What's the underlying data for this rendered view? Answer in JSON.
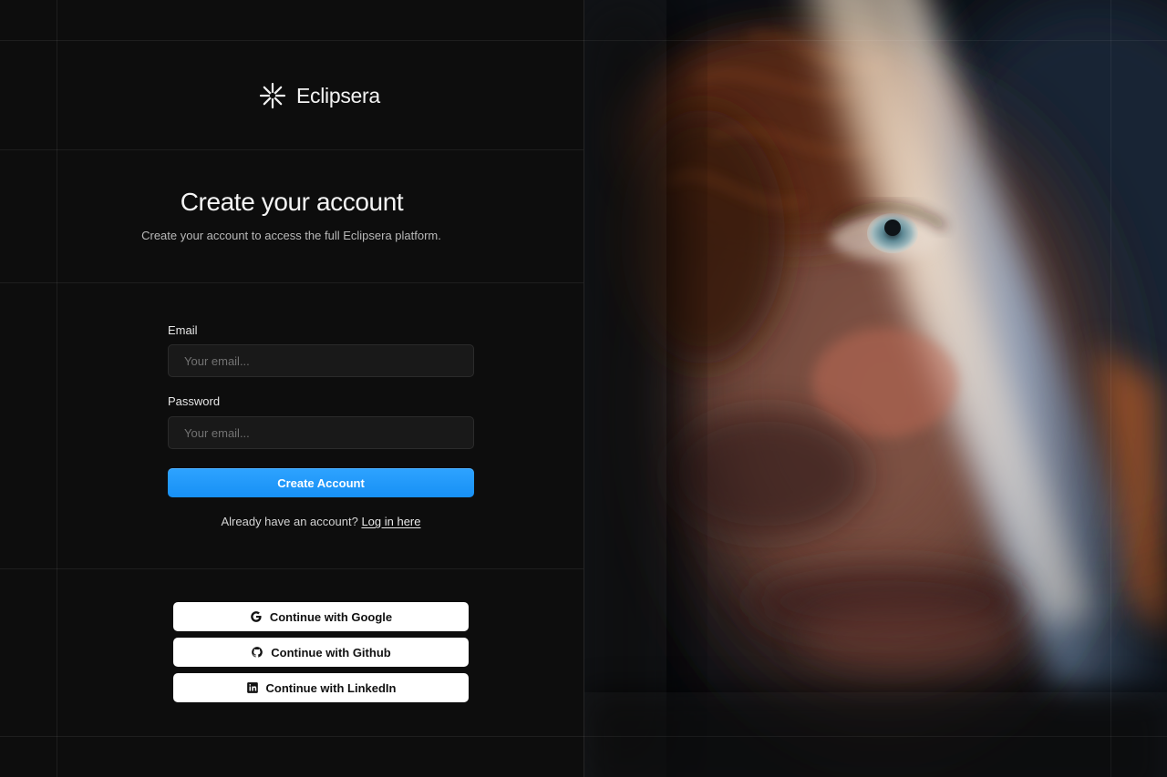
{
  "brand": {
    "name": "Eclipsera",
    "logo_icon": "sparkle-burst-icon"
  },
  "heading": {
    "title": "Create your account",
    "subtitle": "Create your account to access the full Eclipsera platform."
  },
  "form": {
    "email": {
      "label": "Email",
      "placeholder": "Your email...",
      "value": ""
    },
    "password": {
      "label": "Password",
      "placeholder": "Your email...",
      "value": ""
    },
    "submit_label": "Create Account"
  },
  "login_prompt": {
    "text": "Already have an account?",
    "link": "Log in here"
  },
  "social": [
    {
      "label": "Continue with Google",
      "icon": "google-icon"
    },
    {
      "label": "Continue with Github",
      "icon": "github-icon"
    },
    {
      "label": "Continue with LinkedIn",
      "icon": "linkedin-icon"
    }
  ],
  "colors": {
    "background": "#0d0d0d",
    "accent": "#1e96fa",
    "button_light": "#ffffff"
  }
}
